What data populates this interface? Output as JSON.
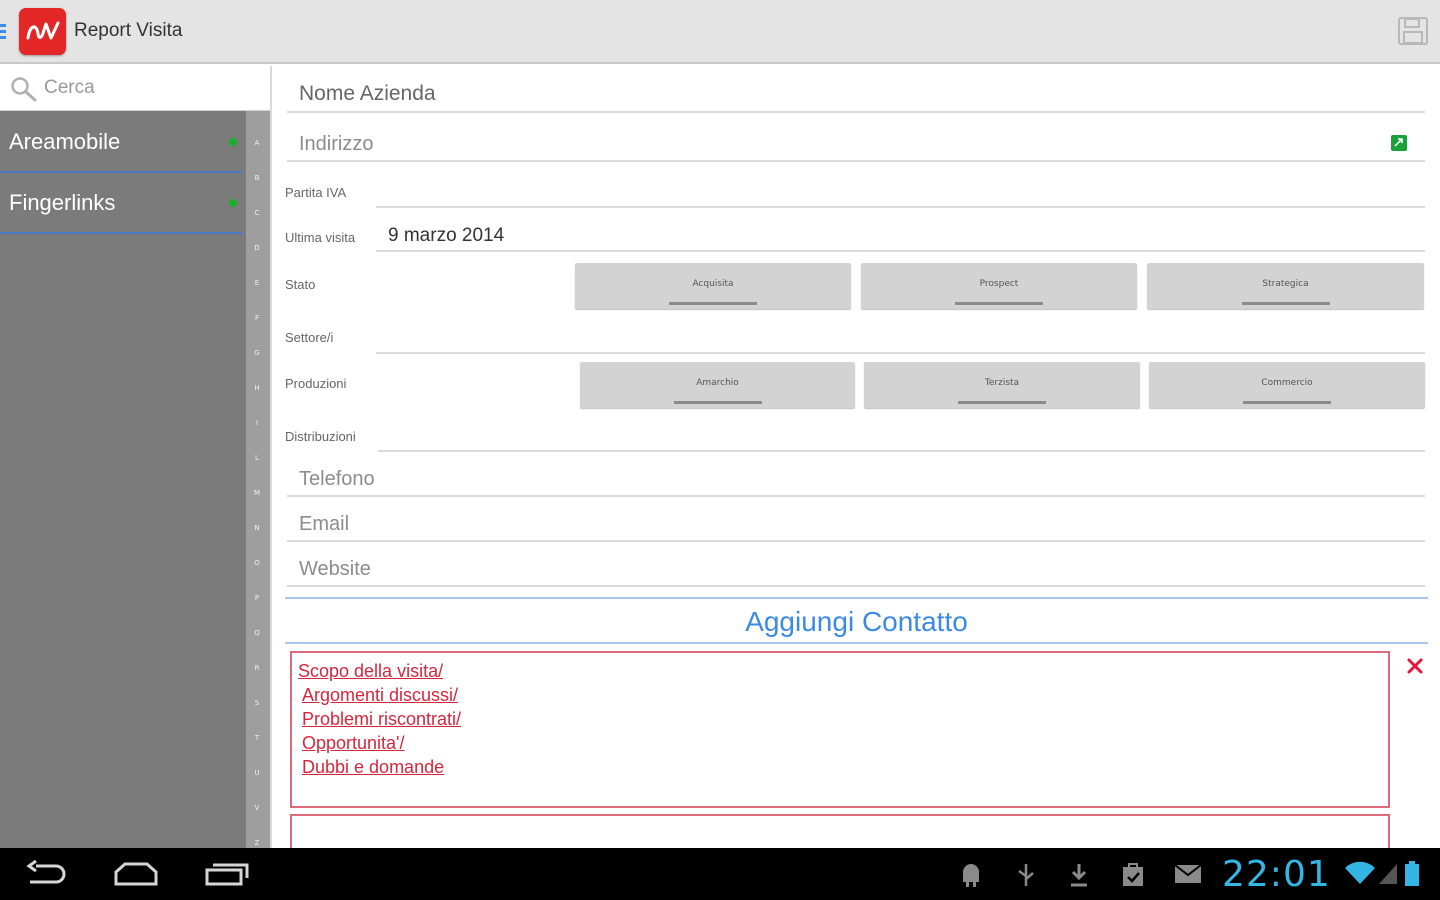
{
  "app": {
    "title": "Report Visita"
  },
  "search": {
    "placeholder": "Cerca"
  },
  "companies": [
    {
      "name": "Areamobile"
    },
    {
      "name": "Fingerlinks"
    }
  ],
  "alpha_index": [
    "A",
    "B",
    "C",
    "D",
    "E",
    "F",
    "G",
    "H",
    "I",
    "L",
    "M",
    "N",
    "O",
    "P",
    "Q",
    "R",
    "S",
    "T",
    "U",
    "V",
    "Z"
  ],
  "form": {
    "company_name_placeholder": "Nome Azienda",
    "address_placeholder": "Indirizzo",
    "vat_label": "Partita IVA",
    "last_visit_label": "Ultima visita",
    "last_visit_value": "9 marzo 2014",
    "status_label": "Stato",
    "status_options": [
      "Acquisita",
      "Prospect",
      "Strategica"
    ],
    "sectors_label": "Settore/i",
    "productions_label": "Produzioni",
    "production_options": [
      "Amarchio",
      "Terzista",
      "Commercio"
    ],
    "distributions_label": "Distribuzioni",
    "phone_placeholder": "Telefono",
    "email_placeholder": "Email",
    "website_placeholder": "Website",
    "add_contact_label": "Aggiungi Contatto",
    "notes_lines": [
      "Scopo della visita/",
      "Argomenti discussi/",
      "Problemi riscontrati/",
      "Opportunita'/",
      "Dubbi e domande"
    ]
  },
  "system": {
    "clock": "22:01"
  },
  "colors": {
    "accent": "#3b8be6",
    "logo": "#e32626",
    "notes": "#d6263e",
    "online": "#17b026"
  }
}
